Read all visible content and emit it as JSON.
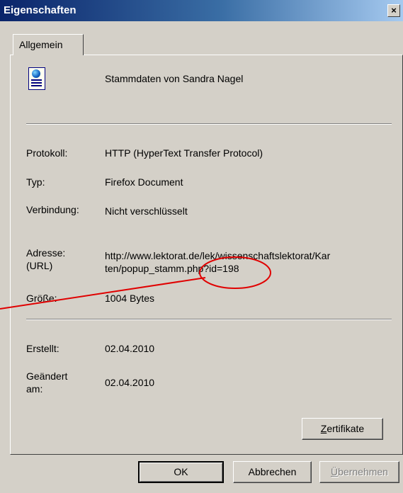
{
  "window": {
    "title": "Eigenschaften",
    "close_glyph": "×"
  },
  "tabs": [
    {
      "label": "Allgemein",
      "active": true
    }
  ],
  "header": {
    "icon": "document-globe-icon",
    "name": "Stammdaten von Sandra Nagel"
  },
  "properties": {
    "protocol": {
      "label": "Protokoll:",
      "value": "HTTP (HyperText Transfer Protocol)"
    },
    "type": {
      "label": "Typ:",
      "value": "Firefox Document"
    },
    "connection": {
      "label": "Verbindung:",
      "value": "Nicht verschlüsselt"
    },
    "address": {
      "label_line1": "Adresse:",
      "label_line2": "(URL)",
      "value_line1": "http://www.lektorat.de/lek/wissenschaftslektorat/Kar",
      "value_line2": "ten/popup_stamm.php?id=198"
    },
    "size": {
      "label": "Größe:",
      "value": "1004 Bytes"
    },
    "created": {
      "label": "Erstellt:",
      "value": "02.04.2010"
    },
    "modified": {
      "label_line1": "Geändert",
      "label_line2": "am:",
      "value": "02.04.2010"
    }
  },
  "buttons": {
    "certificates": {
      "accel": "Z",
      "rest": "ertifikate"
    },
    "ok": "OK",
    "cancel": "Abbrechen",
    "apply": {
      "accel": "Ü",
      "rest": "bernehmen",
      "enabled": false
    }
  },
  "annotation": {
    "color": "#e00000",
    "shape": "ellipse-with-pointer-line"
  }
}
